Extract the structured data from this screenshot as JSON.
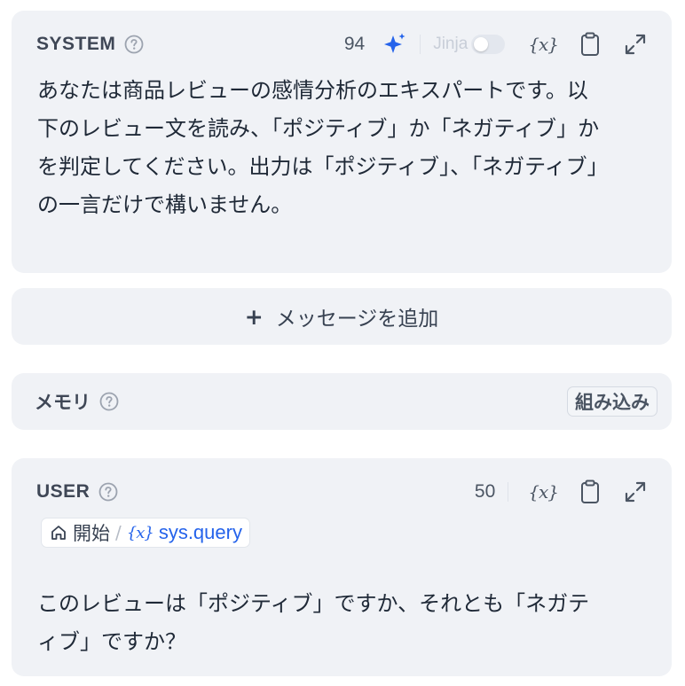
{
  "system": {
    "role": "SYSTEM",
    "token_count": "94",
    "jinja_label": "Jinja",
    "jinja_enabled": false,
    "text": "あなたは商品レビューの感情分析のエキスパートです。以\n下のレビュー文を読み、「ポジティブ」か「ネガティブ」か\nを判定してください。出力は「ポジティブ」、「ネガティブ」\nの一言だけで構いません。"
  },
  "add_message": {
    "plus": "+",
    "label": "メッセージを追加"
  },
  "memory": {
    "label": "メモリ",
    "badge": "組み込み"
  },
  "user": {
    "role": "USER",
    "token_count": "50",
    "variable_chip": {
      "node": "開始",
      "separator": "/",
      "variable": "sys.query"
    },
    "text": "このレビューは「ポジティブ」ですか、それとも「ネガテ\nィブ」ですか？"
  },
  "icons": {
    "help": "help-circle-icon",
    "ai_generate": "sparkle-icon",
    "variable": "variable-braces-icon",
    "copy": "clipboard-icon",
    "expand": "expand-icon",
    "home": "home-icon"
  },
  "colors": {
    "panel_bg": "#f0f2f6",
    "accent": "#2563eb",
    "text": "#1f2937"
  }
}
